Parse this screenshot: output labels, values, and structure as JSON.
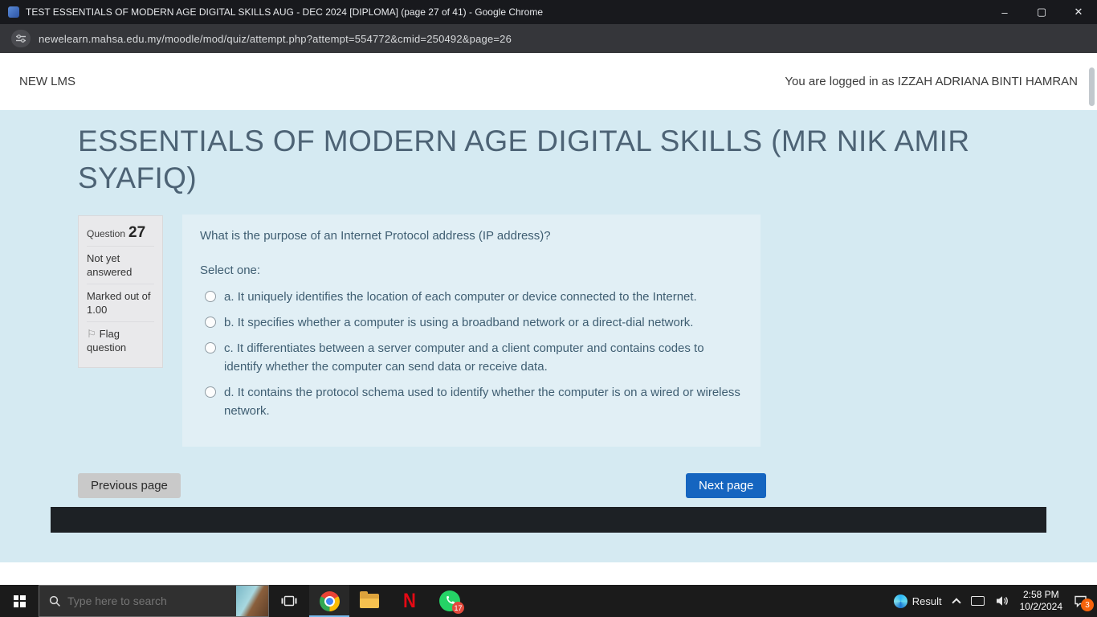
{
  "window": {
    "title": "TEST ESSENTIALS OF MODERN AGE DIGITAL SKILLS AUG - DEC 2024 [DIPLOMA] (page 27 of 41) - Google Chrome",
    "minimize": "–",
    "maximize": "▢",
    "close": "✕"
  },
  "urlbar": {
    "url": "newelearn.mahsa.edu.my/moodle/mod/quiz/attempt.php?attempt=554772&cmid=250492&page=26"
  },
  "header": {
    "brand": "NEW LMS",
    "login_status": "You are logged in as IZZAH ADRIANA BINTI HAMRAN"
  },
  "main": {
    "course_title": "ESSENTIALS OF MODERN AGE DIGITAL SKILLS (MR NIK AMIR SYAFIQ)",
    "question_info": {
      "label": "Question",
      "number": "27",
      "status": "Not yet answered",
      "marks": "Marked out of 1.00",
      "flag_icon": "⚐",
      "flag_label": "Flag question"
    },
    "question": {
      "text": "What is the purpose of an Internet Protocol address (IP address)?",
      "prompt": "Select one:",
      "options": [
        {
          "letter": "a.",
          "text": "It uniquely identifies the location of each computer or device connected to the Internet."
        },
        {
          "letter": "b.",
          "text": "It specifies whether a computer is using a broadband network or a direct-dial network."
        },
        {
          "letter": "c.",
          "text": "It differentiates between a server computer and a client computer and contains codes to identify whether the computer can send data or receive data."
        },
        {
          "letter": "d.",
          "text": "It contains the protocol schema used to identify whether the computer is on a wired or wireless network."
        }
      ]
    },
    "nav": {
      "previous": "Previous page",
      "next": "Next page"
    }
  },
  "taskbar": {
    "search_placeholder": "Type here to search",
    "netflix_glyph": "N",
    "whatsapp_badge": "17",
    "tray_label": "Result",
    "time": "2:58 PM",
    "date": "10/2/2024",
    "notification_badge": "3"
  },
  "colors": {
    "accent_blue": "#1565c0",
    "page_bg": "#d5eaf2",
    "question_bg": "#e1eff5",
    "info_bg": "#e9e9eb",
    "netflix_red": "#e50914",
    "whatsapp_green": "#25d366",
    "taskbar_bg": "#1b1b1b"
  }
}
